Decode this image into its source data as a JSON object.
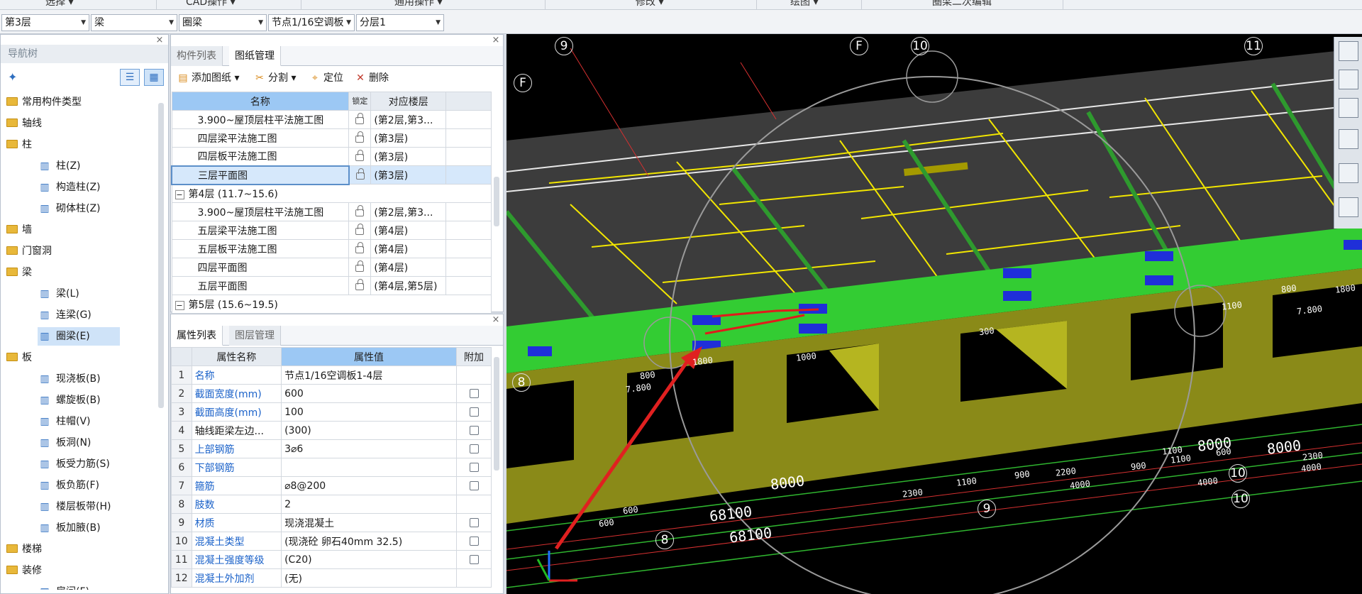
{
  "ribbon": {
    "groups": [
      "选择 ▾",
      "CAD操作 ▾",
      "通用操作 ▾",
      "修改 ▾",
      "绘图 ▾",
      "圈梁二次编辑"
    ]
  },
  "selectors": {
    "floor": "第3层",
    "category": "梁",
    "type": "圈梁",
    "component": "节点1/16空调板",
    "sublayer": "分层1"
  },
  "nav": {
    "title": "导航树",
    "items": [
      {
        "label": "常用构件类型",
        "kind": "folder"
      },
      {
        "label": "轴线",
        "kind": "folder"
      },
      {
        "label": "柱",
        "kind": "folder"
      },
      {
        "label": "柱(Z)",
        "kind": "child",
        "icon": "column-icon"
      },
      {
        "label": "构造柱(Z)",
        "kind": "child",
        "icon": "constructional-column-icon"
      },
      {
        "label": "砌体柱(Z)",
        "kind": "child",
        "icon": "masonry-column-icon"
      },
      {
        "label": "墙",
        "kind": "folder"
      },
      {
        "label": "门窗洞",
        "kind": "folder"
      },
      {
        "label": "梁",
        "kind": "folder"
      },
      {
        "label": "梁(L)",
        "kind": "child",
        "icon": "beam-icon"
      },
      {
        "label": "连梁(G)",
        "kind": "child",
        "icon": "coupling-beam-icon"
      },
      {
        "label": "圈梁(E)",
        "kind": "child",
        "icon": "ring-beam-icon",
        "selected": true
      },
      {
        "label": "板",
        "kind": "folder"
      },
      {
        "label": "现浇板(B)",
        "kind": "child",
        "icon": "cast-slab-icon"
      },
      {
        "label": "螺旋板(B)",
        "kind": "child",
        "icon": "spiral-slab-icon"
      },
      {
        "label": "柱帽(V)",
        "kind": "child",
        "icon": "column-cap-icon"
      },
      {
        "label": "板洞(N)",
        "kind": "child",
        "icon": "slab-hole-icon"
      },
      {
        "label": "板受力筋(S)",
        "kind": "child",
        "icon": "slab-rebar-icon"
      },
      {
        "label": "板负筋(F)",
        "kind": "child",
        "icon": "negative-rebar-icon"
      },
      {
        "label": "楼层板带(H)",
        "kind": "child",
        "icon": "slab-strip-icon"
      },
      {
        "label": "板加腋(B)",
        "kind": "child",
        "icon": "slab-haunch-icon"
      },
      {
        "label": "楼梯",
        "kind": "folder"
      },
      {
        "label": "装修",
        "kind": "folder"
      },
      {
        "label": "房间(F)",
        "kind": "child",
        "icon": "room-icon"
      }
    ]
  },
  "drawings": {
    "tabs": [
      "构件列表",
      "图纸管理"
    ],
    "active_tab": "图纸管理",
    "toolbar": {
      "add": "添加图纸",
      "split": "分割",
      "locate": "定位",
      "delete": "删除"
    },
    "columns": {
      "name": "名称",
      "lock": "锁定",
      "floor": "对应楼层"
    },
    "rows": [
      {
        "name": "3.900~屋顶层柱平法施工图",
        "floor": "(第2层,第3..."
      },
      {
        "name": "四层梁平法施工图",
        "floor": "(第3层)"
      },
      {
        "name": "四层板平法施工图",
        "floor": "(第3层)"
      },
      {
        "name": "三层平面图",
        "floor": "(第3层)",
        "selected": true
      },
      {
        "group": "第4层 (11.7~15.6)"
      },
      {
        "name": "3.900~屋顶层柱平法施工图",
        "floor": "(第2层,第3..."
      },
      {
        "name": "五层梁平法施工图",
        "floor": "(第4层)"
      },
      {
        "name": "五层板平法施工图",
        "floor": "(第4层)"
      },
      {
        "name": "四层平面图",
        "floor": "(第4层)"
      },
      {
        "name": "五层平面图",
        "floor": "(第4层,第5层)"
      },
      {
        "group": "第5层 (15.6~19.5)"
      }
    ]
  },
  "properties": {
    "tabs": [
      "属性列表",
      "图层管理"
    ],
    "active_tab": "属性列表",
    "columns": {
      "name": "属性名称",
      "value": "属性值",
      "extra": "附加"
    },
    "rows": [
      {
        "n": "1",
        "name": "名称",
        "value": "节点1/16空调板1-4层",
        "blue": true,
        "check": false
      },
      {
        "n": "2",
        "name": "截面宽度(mm)",
        "value": "600",
        "blue": true,
        "check": true
      },
      {
        "n": "3",
        "name": "截面高度(mm)",
        "value": "100",
        "blue": true,
        "check": true
      },
      {
        "n": "4",
        "name": "轴线距梁左边...",
        "value": "(300)",
        "blue": false,
        "check": true
      },
      {
        "n": "5",
        "name": "上部钢筋",
        "value": "3⌀6",
        "blue": true,
        "check": true
      },
      {
        "n": "6",
        "name": "下部钢筋",
        "value": "",
        "blue": true,
        "check": true
      },
      {
        "n": "7",
        "name": "箍筋",
        "value": "⌀8@200",
        "blue": true,
        "check": true
      },
      {
        "n": "8",
        "name": "肢数",
        "value": "2",
        "blue": true,
        "check": false
      },
      {
        "n": "9",
        "name": "材质",
        "value": "现浇混凝土",
        "blue": true,
        "check": true
      },
      {
        "n": "10",
        "name": "混凝土类型",
        "value": "(现浇砼 卵石40mm 32.5)",
        "blue": true,
        "check": true
      },
      {
        "n": "11",
        "name": "混凝土强度等级",
        "value": "(C20)",
        "blue": true,
        "check": true
      },
      {
        "n": "12",
        "name": "混凝土外加剂",
        "value": "(无)",
        "blue": true,
        "check": false
      }
    ]
  },
  "viewport": {
    "axis_labels": [
      "9",
      "F",
      "10",
      "11",
      "F",
      "8",
      "9",
      "8",
      "10",
      "10"
    ],
    "dim_labels": [
      "8000",
      "8000",
      "68100",
      "68100",
      "2300",
      "4000",
      "1100",
      "900",
      "2200",
      "4000",
      "1100",
      "600",
      "2300",
      "600",
      "900",
      "1100",
      "600",
      "8000",
      "4000",
      "1800",
      "1000",
      "300",
      "1100",
      "800",
      "1800",
      "7.800",
      "7.800",
      "800"
    ],
    "side_tools": [
      "orbit-icon",
      "view-2d-icon",
      "view-3d-icon",
      "box-view-icon",
      "rotate-icon",
      "layers-icon"
    ]
  }
}
